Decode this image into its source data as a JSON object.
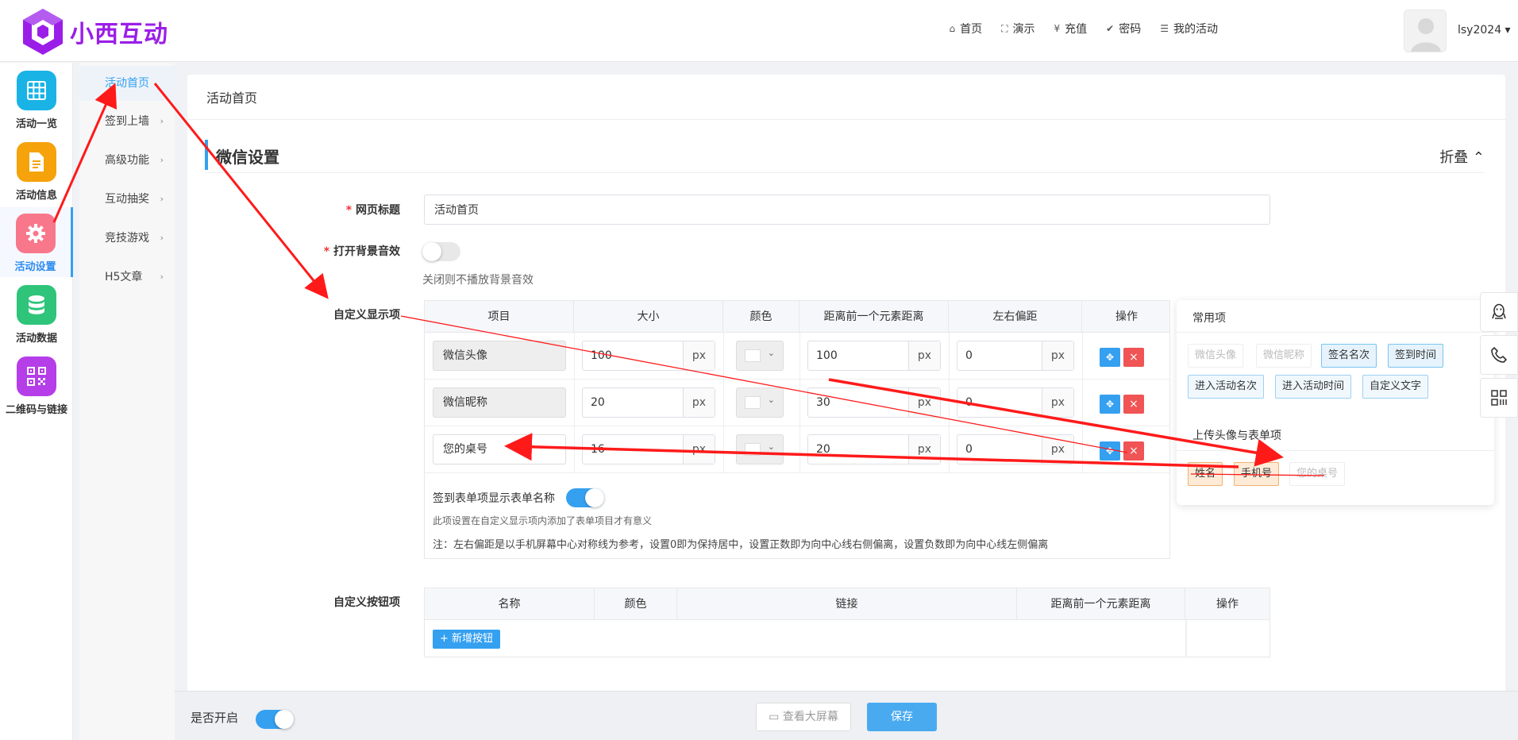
{
  "brand": {
    "name": "小西互动",
    "color": "#9b1ee8"
  },
  "topnav": [
    {
      "icon": "home-icon",
      "glyph": "⌂",
      "label": "首页"
    },
    {
      "icon": "expand-icon",
      "glyph": "⛶",
      "label": "演示"
    },
    {
      "icon": "yen-icon",
      "glyph": "¥",
      "label": "充值"
    },
    {
      "icon": "check-circle-icon",
      "glyph": "✔",
      "label": "密码"
    },
    {
      "icon": "list-icon",
      "glyph": "☰",
      "label": "我的活动"
    }
  ],
  "user": {
    "name": "lsy2024 ▾"
  },
  "sidebar1": [
    {
      "label": "活动一览",
      "color": "#19b3e6",
      "icon": "grid-icon"
    },
    {
      "label": "活动信息",
      "color": "#f5a20b",
      "icon": "document-icon"
    },
    {
      "label": "活动设置",
      "color": "#f8778a",
      "icon": "gear-icon",
      "active": true
    },
    {
      "label": "活动数据",
      "color": "#2ec47a",
      "icon": "database-icon"
    },
    {
      "label": "二维码与链接",
      "color": "#b53ee8",
      "icon": "qrcode-icon"
    }
  ],
  "sidebar2": [
    {
      "label": "活动首页",
      "active": true
    },
    {
      "label": "签到上墙",
      "chev": "›"
    },
    {
      "label": "高级功能",
      "chev": "›"
    },
    {
      "label": "互动抽奖",
      "chev": "›"
    },
    {
      "label": "竞技游戏",
      "chev": "›"
    },
    {
      "label": "H5文章",
      "chev": "›"
    }
  ],
  "page": {
    "title": "活动首页"
  },
  "section": {
    "title": "微信设置",
    "fold": "折叠 ⌃"
  },
  "form": {
    "page_title_label": "网页标题",
    "page_title_value": "活动首页",
    "bg_music_label": "打开背景音效",
    "bg_music_hint": "关闭则不播放背景音效",
    "custom_display_label": "自定义显示项",
    "custom_button_label": "自定义按钮项",
    "req": "* "
  },
  "display_table": {
    "headers": [
      "项目",
      "大小",
      "颜色",
      "距离前一个元素距离",
      "左右偏距",
      "操作"
    ],
    "unit": "px",
    "rows": [
      {
        "name": "微信头像",
        "size": "100",
        "gap": "100",
        "offset": "0"
      },
      {
        "name": "微信昵称",
        "size": "20",
        "gap": "30",
        "offset": "0"
      },
      {
        "name": "您的桌号",
        "size": "16",
        "gap": "20",
        "offset": "0"
      }
    ],
    "move_glyph": "✥",
    "del_glyph": "×",
    "color_chev": "⌄",
    "form_name_label": "签到表单项显示表单名称",
    "form_name_hint": "此项设置在自定义显示项内添加了表单项目才有意义",
    "note": "注：左右偏距是以手机屏幕中心对称线为参考，设置0即为保持居中，设置正数即为向中心线右侧偏离，设置负数即为向中心线左侧偏离"
  },
  "common_panel": {
    "title": "常用项",
    "items": [
      "微信头像",
      "微信昵称",
      "签名名次",
      "签到时间",
      "进入活动名次",
      "进入活动时间",
      "自定义文字"
    ],
    "upload_title": "上传头像与表单项",
    "upload_items": [
      "姓名",
      "手机号",
      "您的桌号"
    ]
  },
  "button_table": {
    "headers": [
      "名称",
      "颜色",
      "链接",
      "距离前一个元素距离",
      "操作"
    ],
    "add_label": "+ 新增按钮"
  },
  "bottom": {
    "enable_label": "是否开启",
    "preview_label": "查看大屏幕",
    "preview_glyph": "▭",
    "save_label": "保存"
  },
  "floating": [
    {
      "icon": "qq-icon"
    },
    {
      "icon": "phone-icon"
    },
    {
      "icon": "qrcode-small-icon"
    }
  ],
  "colors": {
    "accent": "#35a0f0",
    "danger": "#f05454",
    "annotation": "#ff1a1a"
  }
}
